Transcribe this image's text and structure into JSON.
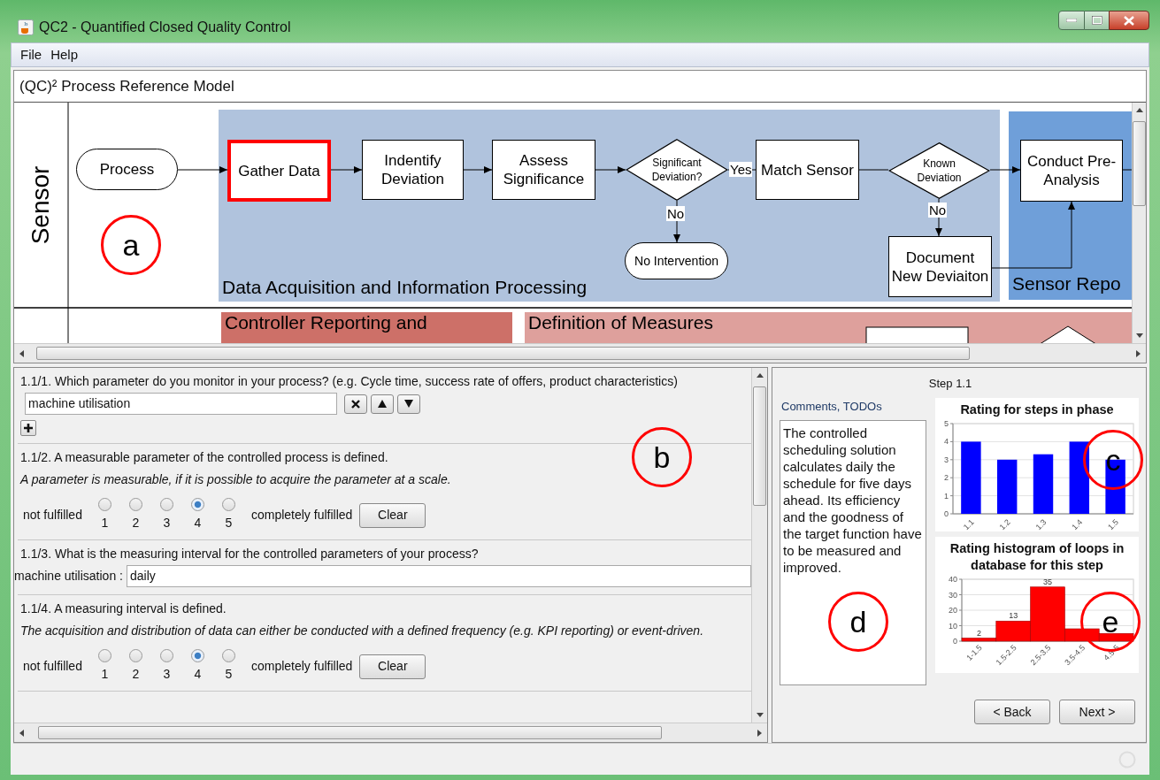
{
  "window": {
    "title": "QC2 - Quantified Closed Quality Control"
  },
  "menu": [
    "File",
    "Help"
  ],
  "model": {
    "title": "(QC)² Process Reference Model",
    "lanes": [
      {
        "label": "Sensor"
      }
    ],
    "groups": [
      {
        "label": "Data Acquisition and Information Processing",
        "color": "#b0c3dd"
      },
      {
        "label": "Sensor Repo",
        "color": "#6f9fd9"
      },
      {
        "label": "Controller Reporting and",
        "color": "#cd7068"
      },
      {
        "label": "Definition of Measures",
        "color": "#dea09c"
      }
    ],
    "nodes": [
      {
        "kind": "terminal",
        "label": "Process",
        "selected": false
      },
      {
        "kind": "task",
        "label": "Gather Data",
        "selected": true
      },
      {
        "kind": "task",
        "label": "Indentify Deviation",
        "selected": false
      },
      {
        "kind": "task",
        "label": "Assess Significance",
        "selected": false
      },
      {
        "kind": "decision",
        "label": "Significant Deviation?",
        "selected": false
      },
      {
        "kind": "task",
        "label": "Match Sensor",
        "selected": false
      },
      {
        "kind": "decision",
        "label": "Known Deviation",
        "selected": false
      },
      {
        "kind": "task",
        "label": "Conduct Pre-Analysis",
        "selected": false
      },
      {
        "kind": "terminal",
        "label": "No Intervention",
        "selected": false
      },
      {
        "kind": "task",
        "label": "Document New Deviaiton",
        "selected": false
      }
    ],
    "edge_labels": [
      "Yes",
      "No",
      "No"
    ]
  },
  "questions": [
    {
      "kind": "list",
      "label": "1.1/1. Which parameter do you monitor in your process? (e.g. Cycle time, success rate of offers, product characteristics)",
      "items": [
        "machine utilisation"
      ]
    },
    {
      "kind": "rating",
      "label": "1.1/2. A measurable parameter of the controlled process is defined.",
      "hint": "A parameter is measurable, if it is possible to acquire the parameter at a scale.",
      "low": "not fulfilled",
      "high": "completely fulfilled",
      "clear": "Clear",
      "options": [
        {
          "label": "1",
          "selected": false
        },
        {
          "label": "2",
          "selected": false
        },
        {
          "label": "3",
          "selected": false
        },
        {
          "label": "4",
          "selected": true
        },
        {
          "label": "5",
          "selected": false
        }
      ]
    },
    {
      "kind": "text",
      "label": "1.1/3. What is the measuring interval for the controlled parameters of your process?",
      "field_label": "machine utilisation :",
      "value": "daily"
    },
    {
      "kind": "rating",
      "label": "1.1/4. A measuring interval is defined.",
      "hint": "The acquisition and distribution of data can either be conducted with a defined frequency (e.g. KPI reporting) or event-driven.",
      "low": "not fulfilled",
      "high": "completely fulfilled",
      "clear": "Clear",
      "options": [
        {
          "label": "1",
          "selected": false
        },
        {
          "label": "2",
          "selected": false
        },
        {
          "label": "3",
          "selected": false
        },
        {
          "label": "4",
          "selected": true
        },
        {
          "label": "5",
          "selected": false
        }
      ]
    }
  ],
  "step": {
    "title": "Step 1.1",
    "comments_title": "Comments, TODOs",
    "comments": "The controlled scheduling solution calculates daily the schedule for five days ahead. Its efficiency and the goodness of the target function have to be measured and improved.",
    "charts": [
      {
        "chart_data": {
          "type": "bar",
          "title": "Rating for steps in phase",
          "categories": [
            "1.1",
            "1.2",
            "1.3",
            "1.4",
            "1.5"
          ],
          "series": [
            {
              "color": "#0000ff",
              "values": [
                4,
                3,
                3.3,
                4,
                3
              ]
            }
          ],
          "grid": true,
          "ylim": [
            0,
            5
          ],
          "yticks": [
            0,
            1,
            2,
            3,
            4,
            5
          ]
        }
      },
      {
        "chart_data": {
          "type": "bar",
          "title": "Rating histogram of loops in database for this step",
          "categories": [
            "1-1.5",
            "1.5-2.5",
            "2.5-3.5",
            "3.5-4.5",
            "4.5-5"
          ],
          "series": [
            {
              "color": "#ff0000",
              "values": [
                2,
                13,
                35,
                8,
                5
              ]
            }
          ],
          "grid": true,
          "ylim": [
            0,
            40
          ],
          "yticks": [
            0,
            10,
            20,
            30,
            40
          ],
          "value_labels": [
            "2",
            "13",
            "35",
            null,
            null
          ]
        }
      }
    ],
    "buttons": [
      "< Back",
      "Next >"
    ]
  },
  "annotations": [
    {
      "label": "a"
    },
    {
      "label": "b"
    },
    {
      "label": "c"
    },
    {
      "label": "d"
    },
    {
      "label": "e"
    }
  ]
}
